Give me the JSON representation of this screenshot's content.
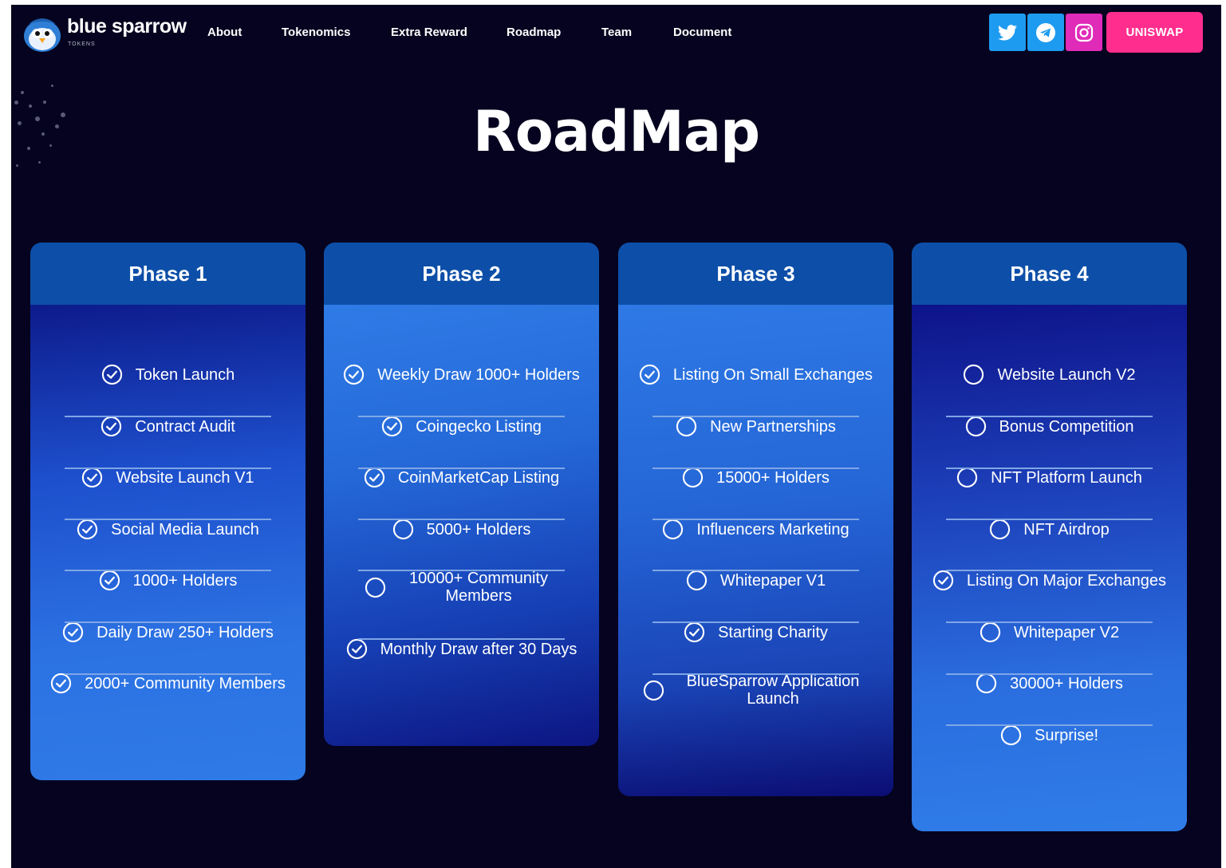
{
  "brand": {
    "name": "blue sparrow",
    "sub": "TOKENS"
  },
  "nav": [
    {
      "label": "About"
    },
    {
      "label": "Tokenomics"
    },
    {
      "label": "Extra Reward"
    },
    {
      "label": "Roadmap"
    },
    {
      "label": "Team"
    },
    {
      "label": "Document"
    }
  ],
  "social": [
    {
      "icon": "twitter-icon",
      "color": "#1d9bf0"
    },
    {
      "icon": "telegram-icon",
      "color": "#1d9bf0"
    },
    {
      "icon": "instagram-icon",
      "color": "#e02ab8"
    }
  ],
  "cta": {
    "label": "UNISWAP",
    "color": "#ff2e8e"
  },
  "title": "RoadMap",
  "phases": [
    {
      "title": "Phase 1",
      "items": [
        {
          "label": "Token Launch",
          "done": true
        },
        {
          "label": "Contract Audit",
          "done": true
        },
        {
          "label": "Website Launch V1",
          "done": true
        },
        {
          "label": "Social Media Launch",
          "done": true
        },
        {
          "label": "1000+ Holders",
          "done": true
        },
        {
          "label": "Daily Draw 250+ Holders",
          "done": true
        },
        {
          "label": "2000+ Community Members",
          "done": true
        }
      ]
    },
    {
      "title": "Phase 2",
      "items": [
        {
          "label": "Weekly Draw 1000+ Holders",
          "done": true
        },
        {
          "label": "Coingecko Listing",
          "done": true
        },
        {
          "label": "CoinMarketCap Listing",
          "done": true
        },
        {
          "label": "5000+ Holders",
          "done": false
        },
        {
          "label": "10000+ Community Members",
          "done": false
        },
        {
          "label": "Monthly Draw after 30 Days",
          "done": true
        }
      ]
    },
    {
      "title": "Phase 3",
      "items": [
        {
          "label": "Listing On Small Exchanges",
          "done": true
        },
        {
          "label": "New Partnerships",
          "done": false
        },
        {
          "label": "15000+ Holders",
          "done": false
        },
        {
          "label": "Influencers Marketing",
          "done": false
        },
        {
          "label": "Whitepaper V1",
          "done": false
        },
        {
          "label": "Starting Charity",
          "done": true
        },
        {
          "label": "BlueSparrow Application Launch",
          "done": false
        }
      ]
    },
    {
      "title": "Phase 4",
      "items": [
        {
          "label": "Website Launch V2",
          "done": false
        },
        {
          "label": "Bonus Competition",
          "done": false
        },
        {
          "label": "NFT Platform Launch",
          "done": false
        },
        {
          "label": "NFT Airdrop",
          "done": false
        },
        {
          "label": "Listing On Major Exchanges",
          "done": true
        },
        {
          "label": "Whitepaper V2",
          "done": false
        },
        {
          "label": "30000+ Holders",
          "done": false
        },
        {
          "label": "Surprise!",
          "done": false
        }
      ]
    }
  ]
}
